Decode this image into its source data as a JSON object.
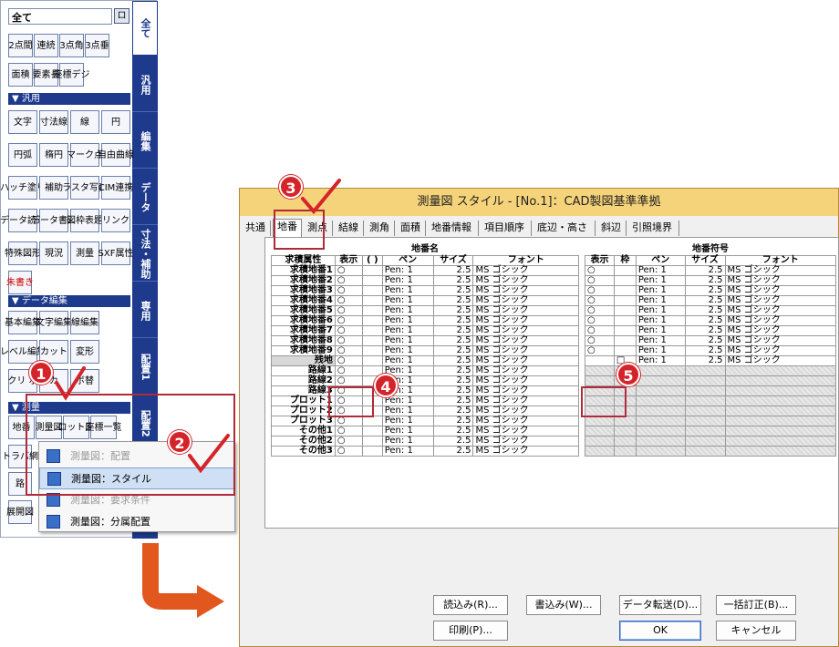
{
  "tool_panel": {
    "filter": "全て",
    "filter_btn": "ロ",
    "tools_row1": [
      "2点間",
      "連続",
      "3点角",
      "3点垂"
    ],
    "tools_row2": [
      "面積",
      "要素長",
      "座標デジ"
    ],
    "section_general": "▼ 汎用",
    "tools_general": [
      [
        "文字",
        "寸法線",
        "線",
        "円"
      ],
      [
        "円弧",
        "楕円",
        "マーク点",
        "自由曲線"
      ],
      [
        "ハッチ塗り",
        "補助",
        "ラスタ写真",
        "CIM連携"
      ],
      [
        "データ読込",
        "データ書込",
        "図枠表題",
        "リンク"
      ],
      [
        "特殊図形",
        "現況",
        "測量",
        "SXF属性"
      ]
    ],
    "tool_red": "朱書き",
    "section_data": "▼ データ編集",
    "tools_data": [
      [
        "基本編集",
        "文字編集",
        "線編集"
      ],
      [
        "レベル編集",
        "カット",
        "変形"
      ],
      [
        "クリ ボ",
        "カ",
        "ボ替"
      ]
    ],
    "section_survey": "▼ 測量",
    "tools_survey": [
      "地番",
      "測量図",
      "ロット図",
      "座標一覧"
    ],
    "tools_survey2": [
      "トラバ網",
      "路"
    ],
    "tools_bottom": "展開図",
    "vtabs": [
      "全て",
      "汎用",
      "編集",
      "データ",
      "寸法・補助",
      "専用",
      "配置1",
      "配置2"
    ]
  },
  "context_menu": {
    "items": [
      {
        "label": "測量図：配置",
        "state": "faded"
      },
      {
        "label": "測量図：スタイル",
        "state": "highlight"
      },
      {
        "label": "測量図：要求条件",
        "state": "faded"
      },
      {
        "label": "測量図：分属配置",
        "state": "normal"
      }
    ]
  },
  "dialog": {
    "title": "測量図 スタイル - [No.1]：CAD製図基準準拠",
    "tabs": [
      "共通",
      "地番",
      "測点",
      "結線",
      "測角",
      "面積",
      "地番情報",
      "項目順序",
      "底辺・高さ",
      "斜辺",
      "引照境界"
    ],
    "selected_tab": "地番",
    "left_table": {
      "group_title": "地番名",
      "headers": [
        "求積属性",
        "表示",
        "( )",
        "ペン",
        "サイズ",
        "フォント"
      ],
      "rows": [
        [
          "求積地番1",
          "○",
          "",
          "Pen: 1",
          "2.5",
          "MS ゴシック"
        ],
        [
          "求積地番2",
          "○",
          "",
          "Pen: 1",
          "2.5",
          "MS ゴシック"
        ],
        [
          "求積地番3",
          "○",
          "",
          "Pen: 1",
          "2.5",
          "MS ゴシック"
        ],
        [
          "求積地番4",
          "○",
          "",
          "Pen: 1",
          "2.5",
          "MS ゴシック"
        ],
        [
          "求積地番5",
          "○",
          "",
          "Pen: 1",
          "2.5",
          "MS ゴシック"
        ],
        [
          "求積地番6",
          "○",
          "",
          "Pen: 1",
          "2.5",
          "MS ゴシック"
        ],
        [
          "求積地番7",
          "○",
          "",
          "Pen: 1",
          "2.5",
          "MS ゴシック"
        ],
        [
          "求積地番8",
          "○",
          "",
          "Pen: 1",
          "2.5",
          "MS ゴシック"
        ],
        [
          "求積地番9",
          "○",
          "",
          "Pen: 1",
          "2.5",
          "MS ゴシック"
        ],
        [
          "残地",
          "○",
          "",
          "Pen: 1",
          "2.5",
          "MS ゴシック"
        ],
        [
          "路線1",
          "○",
          "",
          "Pen: 1",
          "2.5",
          "MS ゴシック"
        ],
        [
          "路線2",
          "○",
          "",
          "Pen: 1",
          "2.5",
          "MS ゴシック"
        ],
        [
          "路線3",
          "○",
          "",
          "Pen: 1",
          "2.5",
          "MS ゴシック"
        ],
        [
          "プロット1",
          "○",
          "",
          "Pen: 1",
          "2.5",
          "MS ゴシック"
        ],
        [
          "プロット2",
          "○",
          "",
          "Pen: 1",
          "2.5",
          "MS ゴシック"
        ],
        [
          "プロット3",
          "○",
          "",
          "Pen: 1",
          "2.5",
          "MS ゴシック"
        ],
        [
          "その他1",
          "○",
          "",
          "Pen: 1",
          "2.5",
          "MS ゴシック"
        ],
        [
          "その他2",
          "○",
          "",
          "Pen: 1",
          "2.5",
          "MS ゴシック"
        ],
        [
          "その他3",
          "○",
          "",
          "Pen: 1",
          "2.5",
          "MS ゴシック"
        ]
      ]
    },
    "right_table": {
      "group_title": "地番符号",
      "headers": [
        "表示",
        "枠",
        "ペン",
        "サイズ",
        "フォント"
      ],
      "rows": [
        [
          "○",
          "",
          "Pen: 1",
          "2.5",
          "MS ゴシック"
        ],
        [
          "○",
          "",
          "Pen: 1",
          "2.5",
          "MS ゴシック"
        ],
        [
          "○",
          "",
          "Pen: 1",
          "2.5",
          "MS ゴシック"
        ],
        [
          "○",
          "",
          "Pen: 1",
          "2.5",
          "MS ゴシック"
        ],
        [
          "○",
          "",
          "Pen: 1",
          "2.5",
          "MS ゴシック"
        ],
        [
          "○",
          "",
          "Pen: 1",
          "2.5",
          "MS ゴシック"
        ],
        [
          "○",
          "",
          "Pen: 1",
          "2.5",
          "MS ゴシック"
        ],
        [
          "○",
          "",
          "Pen: 1",
          "2.5",
          "MS ゴシック"
        ],
        [
          "○",
          "",
          "Pen: 1",
          "2.5",
          "MS ゴシック"
        ],
        [
          "",
          "□",
          "Pen: 1",
          "2.5",
          "MS ゴシック"
        ]
      ]
    },
    "buttons": {
      "read": "読込み(R)...",
      "write": "書込み(W)...",
      "transfer": "データ転送(D)...",
      "bulk": "一括訂正(B)...",
      "print": "印刷(P)...",
      "ok": "OK",
      "cancel": "キャンセル"
    }
  },
  "annotations": [
    "1",
    "2",
    "3",
    "4",
    "5"
  ],
  "colors": {
    "accent": "#1d3a8c",
    "marker": "#d4242a",
    "arrow": "#e2571e",
    "titlebar": "#f5d37a"
  }
}
